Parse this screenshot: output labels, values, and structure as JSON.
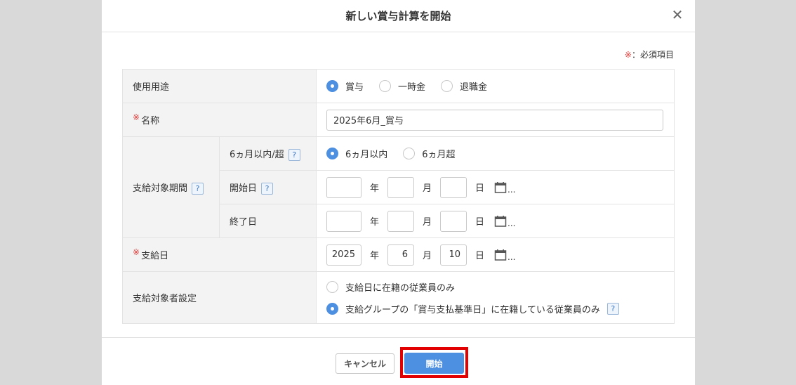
{
  "dialog": {
    "title": "新しい賞与計算を開始",
    "close_symbol": "✕",
    "required_mark": "※",
    "required_text": "：必須項目"
  },
  "form": {
    "usage": {
      "label": "使用用途",
      "options": [
        "賞与",
        "一時金",
        "退職金"
      ],
      "selected": "賞与"
    },
    "name": {
      "required_mark": "※",
      "label": "名称",
      "value": "2025年6月_賞与"
    },
    "period": {
      "label": "支給対象期間",
      "help": "?",
      "within": {
        "label": "6ヵ月以内/超",
        "help": "?",
        "options": [
          "6ヵ月以内",
          "6ヵ月超"
        ],
        "selected": "6ヵ月以内"
      },
      "start": {
        "label": "開始日",
        "help": "?",
        "year": "",
        "month": "",
        "day": ""
      },
      "end": {
        "label": "終了日",
        "year": "",
        "month": "",
        "day": ""
      }
    },
    "pay_date": {
      "required_mark": "※",
      "label": "支給日",
      "year": "2025",
      "month": "6",
      "day": "10"
    },
    "units": {
      "year": "年",
      "month": "月",
      "day": "日",
      "more": "..."
    },
    "target": {
      "label": "支給対象者設定",
      "options": [
        "支給日に在籍の従業員のみ",
        "支給グループの「賞与支払基準日」に在籍している従業員のみ"
      ],
      "selected": "支給グループの「賞与支払基準日」に在籍している従業員のみ",
      "help": "?"
    }
  },
  "footer": {
    "cancel_label": "キャンセル",
    "start_label": "開始"
  },
  "colors": {
    "accent": "#4d8fe0",
    "highlight": "#e30000",
    "required": "#e53935"
  }
}
